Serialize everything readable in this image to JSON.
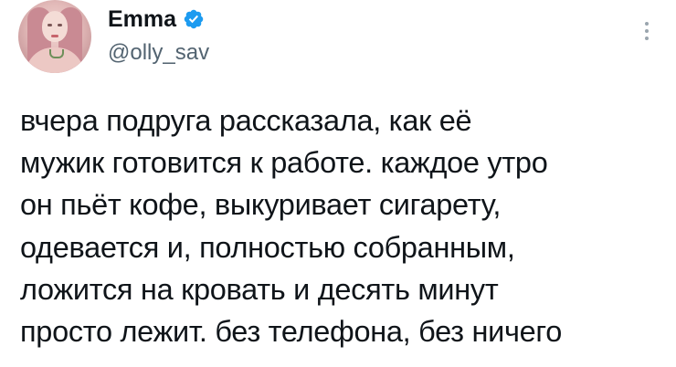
{
  "author": {
    "display_name": "Emma",
    "handle": "@olly_sav",
    "verified": true
  },
  "tweet": {
    "lines": [
      "вчера подруга рассказала, как её",
      "мужик готовится к работе. каждое утро",
      "он пьёт кофе, выкуривает сигарету,",
      "одевается и, полностью собранным,",
      "ложится на кровать и десять минут",
      "просто лежит. без телефона, без ничего"
    ]
  },
  "icons": {
    "verified": "verified-badge-icon",
    "more": "more-options-icon"
  },
  "colors": {
    "verified_blue": "#1d9bf0",
    "text": "#0f1419",
    "secondary_text": "#536471"
  }
}
